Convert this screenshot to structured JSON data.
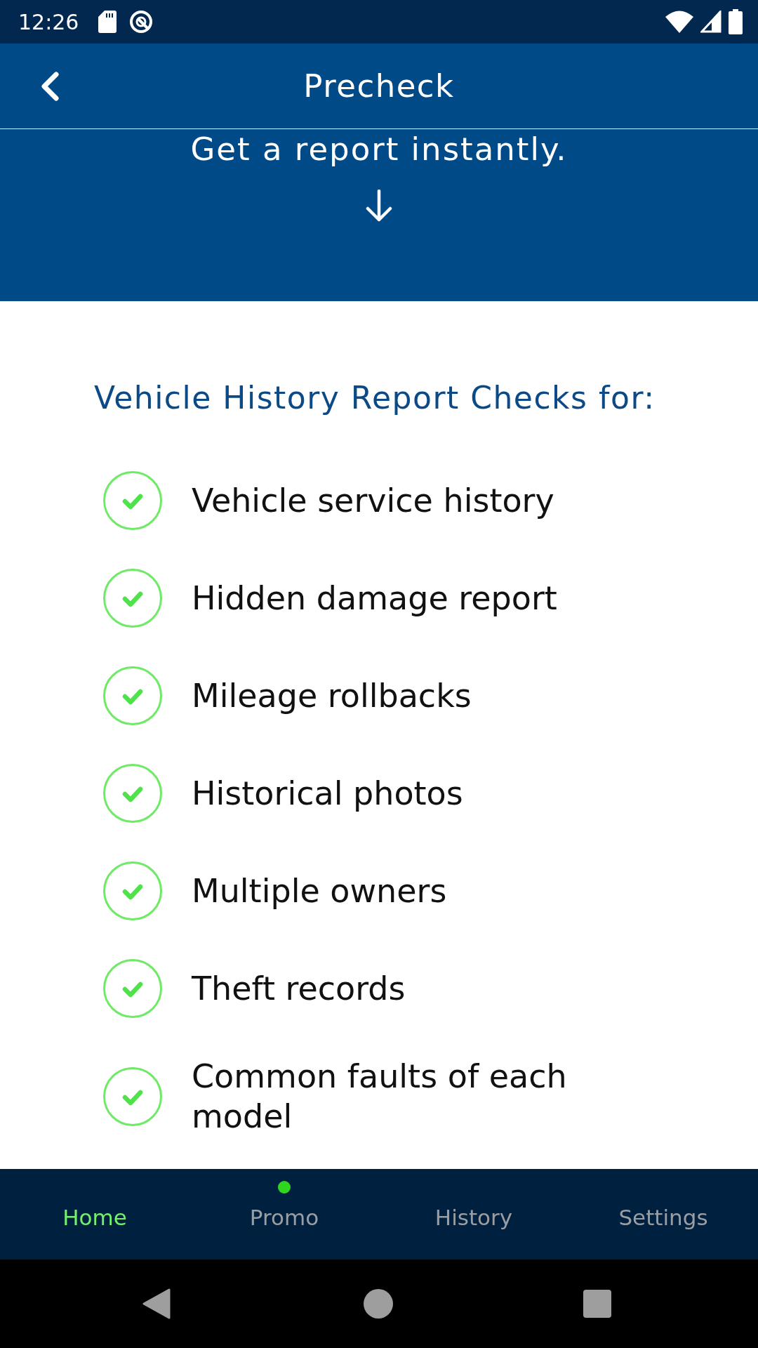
{
  "status_bar": {
    "time": "12:26"
  },
  "header": {
    "title": "Precheck"
  },
  "hero": {
    "subtitle": "Get a report instantly."
  },
  "checks": {
    "heading": "Vehicle History Report Checks for:",
    "items": [
      {
        "label": "Vehicle service history"
      },
      {
        "label": "Hidden damage report"
      },
      {
        "label": "Mileage rollbacks"
      },
      {
        "label": "Historical photos"
      },
      {
        "label": "Multiple owners"
      },
      {
        "label": "Theft records"
      },
      {
        "label": "Common faults of each model"
      }
    ]
  },
  "bottom_nav": {
    "tabs": [
      {
        "label": "Home",
        "selected": true,
        "dot": false
      },
      {
        "label": "Promo",
        "selected": false,
        "dot": true
      },
      {
        "label": "History",
        "selected": false,
        "dot": false
      },
      {
        "label": "Settings",
        "selected": false,
        "dot": false
      }
    ]
  }
}
